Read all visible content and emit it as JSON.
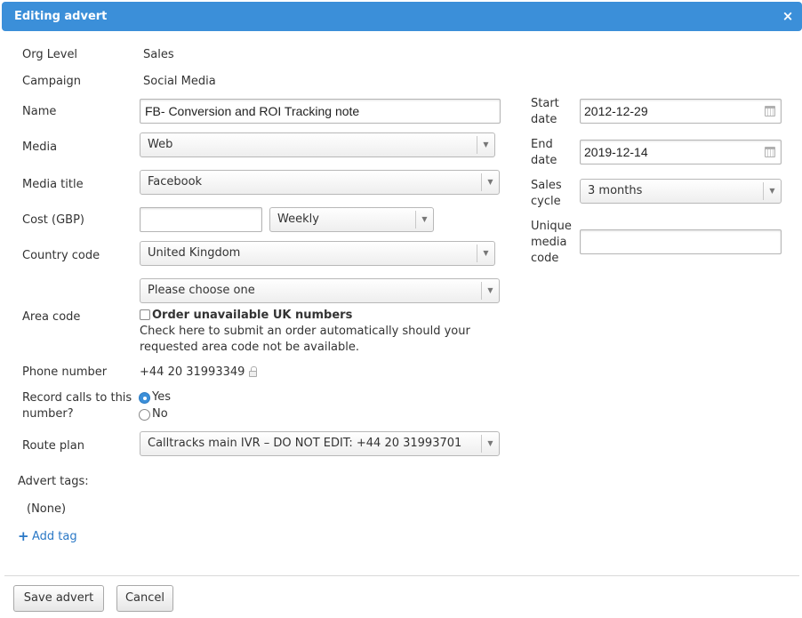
{
  "dialog": {
    "title": "Editing advert",
    "close_glyph": "×"
  },
  "form": {
    "org_level": {
      "label": "Org Level",
      "value": "Sales"
    },
    "campaign": {
      "label": "Campaign",
      "value": "Social Media"
    },
    "name": {
      "label": "Name",
      "value": "FB- Conversion and ROI Tracking note"
    },
    "media": {
      "label": "Media",
      "value": "Web"
    },
    "media_title": {
      "label": "Media title",
      "value": "Facebook"
    },
    "cost": {
      "label": "Cost (GBP)",
      "value": "",
      "period": "Weekly"
    },
    "country_code": {
      "label": "Country code",
      "value": "United Kingdom"
    },
    "area_code": {
      "label": "Area code",
      "value": "Please choose one",
      "checkbox_label": "Order unavailable UK numbers",
      "help_line1": "Check here to submit an order automatically should your",
      "help_line2": "requested area code not be available."
    },
    "phone_number": {
      "label": "Phone number",
      "value": "+44 20 31993349"
    },
    "record_calls": {
      "label_line1": "Record calls to this",
      "label_line2": "number?",
      "yes": "Yes",
      "no": "No",
      "selected": "Yes"
    },
    "route_plan": {
      "label": "Route plan",
      "value": "Calltracks main IVR – DO NOT EDIT: +44 20 31993701"
    },
    "advert_tags": {
      "label": "Advert tags:",
      "empty": "(None)",
      "add_tag": "Add tag",
      "add_icon": "+"
    }
  },
  "right": {
    "start_date": {
      "label_line1": "Start",
      "label_line2": "date",
      "value": "2012-12-29"
    },
    "end_date": {
      "label_line1": "End",
      "label_line2": "date",
      "value": "2019-12-14"
    },
    "sales_cycle": {
      "label_line1": "Sales",
      "label_line2": "cycle",
      "value": "3 months"
    },
    "unique_media_code": {
      "label_line1": "Unique",
      "label_line2": "media",
      "label_line3": "code",
      "value": ""
    }
  },
  "buttons": {
    "save": "Save advert",
    "cancel": "Cancel"
  },
  "colors": {
    "accent": "#3b8fd9",
    "link": "#2a78c6"
  }
}
